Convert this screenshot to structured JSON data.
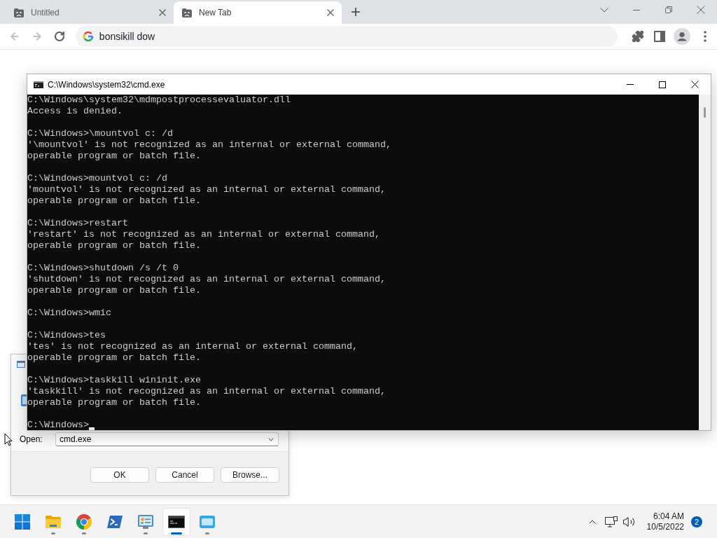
{
  "browser": {
    "tabs": [
      {
        "title": "Untitled",
        "selected": false
      },
      {
        "title": "New Tab",
        "selected": true
      }
    ],
    "back": {
      "disabled": true
    },
    "forward": {
      "disabled": true
    },
    "address_bar": {
      "value": "bonsikill dow"
    }
  },
  "cmd_window": {
    "title": "C:\\Windows\\system32\\cmd.exe",
    "blocks": [
      {
        "lines": [
          "C:\\Windows\\system32\\mdmpostprocessevaluator.dll",
          "Access is denied."
        ]
      },
      {
        "lines": [
          "C:\\Windows>\\mountvol c: /d",
          "'\\mountvol' is not recognized as an internal or external command,",
          "operable program or batch file."
        ]
      },
      {
        "lines": [
          "C:\\Windows>mountvol c: /d",
          "'mountvol' is not recognized as an internal or external command,",
          "operable program or batch file."
        ]
      },
      {
        "lines": [
          "C:\\Windows>restart",
          "'restart' is not recognized as an internal or external command,",
          "operable program or batch file."
        ]
      },
      {
        "lines": [
          "C:\\Windows>shutdown /s /t 0",
          "'shutdown' is not recognized as an internal or external command,",
          "operable program or batch file."
        ]
      },
      {
        "lines": [
          "C:\\Windows>wmic"
        ]
      },
      {
        "lines": [
          "C:\\Windows>tes",
          "'tes' is not recognized as an internal or external command,",
          "operable program or batch file."
        ]
      },
      {
        "lines": [
          "C:\\Windows>taskkill wininit.exe",
          "'taskkill' is not recognized as an internal or external command,",
          "operable program or batch file."
        ]
      }
    ],
    "prompt": "C:\\Windows>"
  },
  "run_dialog": {
    "open_label": "Open:",
    "command_field": {
      "value": "cmd.exe"
    },
    "buttons": [
      "OK",
      "Cancel",
      "Browse..."
    ]
  },
  "taskbar": {
    "apps": [
      {
        "kind": "start",
        "running": false,
        "active": false
      },
      {
        "kind": "folder",
        "running": true,
        "active": false
      },
      {
        "kind": "browser",
        "running": true,
        "active": false
      },
      {
        "kind": "shell",
        "running": false,
        "active": false
      },
      {
        "kind": "panel",
        "running": true,
        "active": false
      },
      {
        "kind": "console",
        "running": true,
        "active": true
      },
      {
        "kind": "window",
        "running": true,
        "active": false
      }
    ],
    "clock": {
      "time": "6:04 AM",
      "date": "10/5/2022"
    },
    "notification_count": "2"
  }
}
